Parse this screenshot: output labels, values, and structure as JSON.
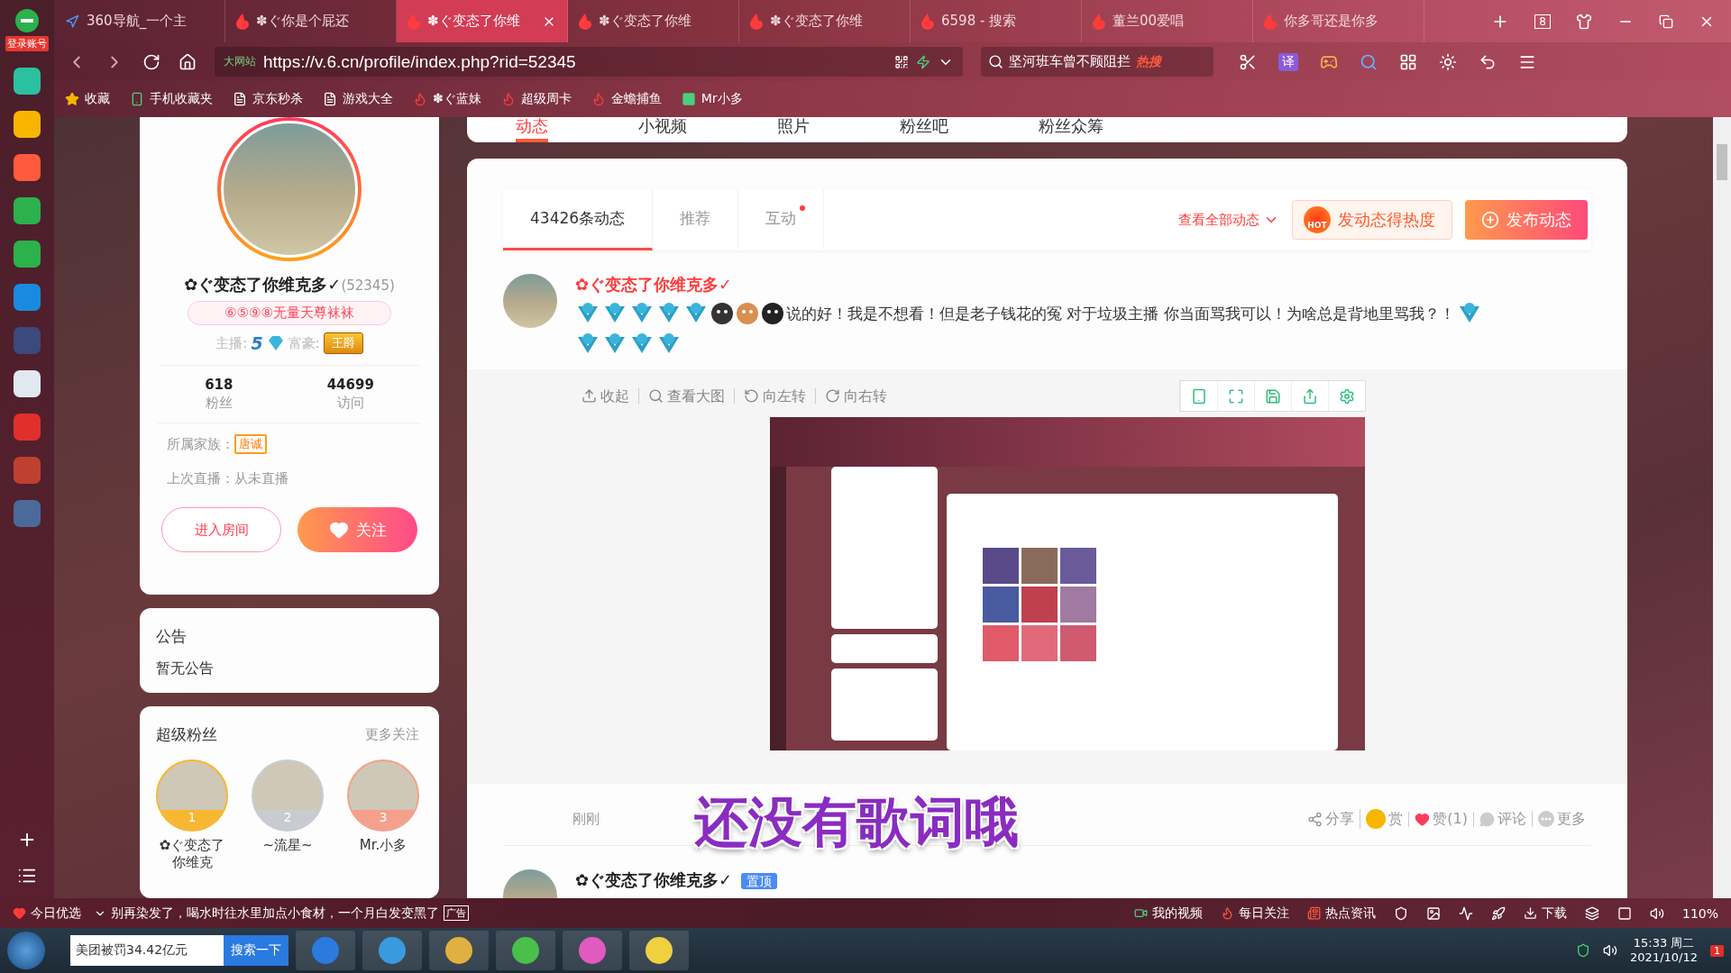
{
  "browser": {
    "login": "登录账号",
    "tabs": [
      {
        "title": "360导航_一个主",
        "selected": false,
        "kind": "nav"
      },
      {
        "title": "✽ぐ你是个屁还",
        "selected": false,
        "kind": "six"
      },
      {
        "title": "✽ぐ变态了你维",
        "selected": true,
        "kind": "six"
      },
      {
        "title": "✽ぐ变态了你维",
        "selected": false,
        "kind": "six"
      },
      {
        "title": "✽ぐ变态了你维",
        "selected": false,
        "kind": "six"
      },
      {
        "title": "6598 - 搜索",
        "selected": false,
        "kind": "six"
      },
      {
        "title": "董兰00爱唱",
        "selected": false,
        "kind": "six"
      },
      {
        "title": "你多哥还是你多",
        "selected": false,
        "kind": "six"
      }
    ],
    "tab_count": "8",
    "url_badge": "大网站",
    "url": "https://v.6.cn/profile/index.php?rid=52345",
    "search": "坚河班车曾不顾阻拦",
    "search_badge": "热搜",
    "translate": "译",
    "bookmarks": [
      {
        "label": "收藏",
        "kind": "star"
      },
      {
        "label": "手机收藏夹",
        "kind": "phone"
      },
      {
        "label": "京东秒杀",
        "kind": "page"
      },
      {
        "label": "游戏大全",
        "kind": "page"
      },
      {
        "label": "✽ぐ蓝妹",
        "kind": "six"
      },
      {
        "label": "超级周卡",
        "kind": "six"
      },
      {
        "label": "金蟾捕鱼",
        "kind": "six"
      },
      {
        "label": "Mr小多",
        "kind": "green"
      }
    ]
  },
  "site_nav": [
    {
      "label": "动态",
      "selected": true
    },
    {
      "label": "小视频",
      "selected": false
    },
    {
      "label": "照片",
      "selected": false
    },
    {
      "label": "粉丝吧",
      "selected": false
    },
    {
      "label": "粉丝众筹",
      "selected": false
    }
  ],
  "profile": {
    "name": "✿ぐ变态了你维克多✓",
    "id": "(52345)",
    "tag": "⑥⑤⑨⑧无量天尊袜袜",
    "anchor_label": "主播:",
    "anchor_level": "5",
    "rich_label": "富豪:",
    "rich_badge": "王爵",
    "stats": [
      {
        "value": "618",
        "label": "粉丝"
      },
      {
        "value": "44699",
        "label": "访问"
      }
    ],
    "family_label": "所属家族：",
    "family": "唐诚",
    "last_live": "上次直播：从未直播",
    "enter_button": "进入房间",
    "follow_button": "关注"
  },
  "notice": {
    "title": "公告",
    "text": "暂无公告"
  },
  "super_fans": {
    "title": "超级粉丝",
    "more": "更多关注",
    "fans": [
      {
        "rank": "1",
        "name": "✿ぐ变态了你维克",
        "color": "#f7b731"
      },
      {
        "rank": "2",
        "name": "~流星~",
        "color": "#c8ccd2"
      },
      {
        "rank": "3",
        "name": "Mr.小多",
        "color": "#f4a08c"
      }
    ]
  },
  "feed": {
    "tabs": [
      {
        "label": "43426条动态",
        "selected": true,
        "dot": false
      },
      {
        "label": "推荐",
        "selected": false,
        "dot": false
      },
      {
        "label": "互动",
        "selected": false,
        "dot": true
      }
    ],
    "view_all": "查看全部动态",
    "hot_badge": "HOT",
    "hot_button": "发动态得热度",
    "publish_button": "发布动态"
  },
  "post": {
    "author": "✿ぐ变态了你维克多✓",
    "text": "说的好！我是不想看！但是老子钱花的冤 对于垃圾主播 你当面骂我可以！为啥总是背地里骂我？！",
    "image_tools": [
      {
        "label": "收起",
        "kind": "collapse"
      },
      {
        "label": "查看大图",
        "kind": "zoom"
      },
      {
        "label": "向左转",
        "kind": "left"
      },
      {
        "label": "向右转",
        "kind": "right"
      }
    ],
    "time": "刚刚",
    "actions": [
      {
        "label": "分享",
        "kind": "share"
      },
      {
        "label": "赏",
        "kind": "reward"
      },
      {
        "label": "赞(1)",
        "kind": "like"
      },
      {
        "label": "评论",
        "kind": "comment"
      },
      {
        "label": "更多",
        "kind": "more"
      }
    ]
  },
  "next_post": {
    "author": "✿ぐ变态了你维克多✓",
    "pinned": "置顶"
  },
  "lyric_overlay": "还没有歌词哦",
  "status_bar": {
    "today": "今日优选",
    "news": "别再染发了，喝水时往水里加点小食材，一个月白发变黑了",
    "news_tag": "广告",
    "items": [
      {
        "label": "我的视频",
        "kind": "video"
      },
      {
        "label": "每日关注",
        "kind": "flame"
      },
      {
        "label": "热点资讯",
        "kind": "news"
      }
    ],
    "download": "下载",
    "zoom": "110%"
  },
  "taskbar": {
    "search": "美团被罚34.42亿元",
    "search_button": "搜索一下",
    "time": "15:33 周二",
    "date": "2021/10/12",
    "notifications": "1"
  }
}
